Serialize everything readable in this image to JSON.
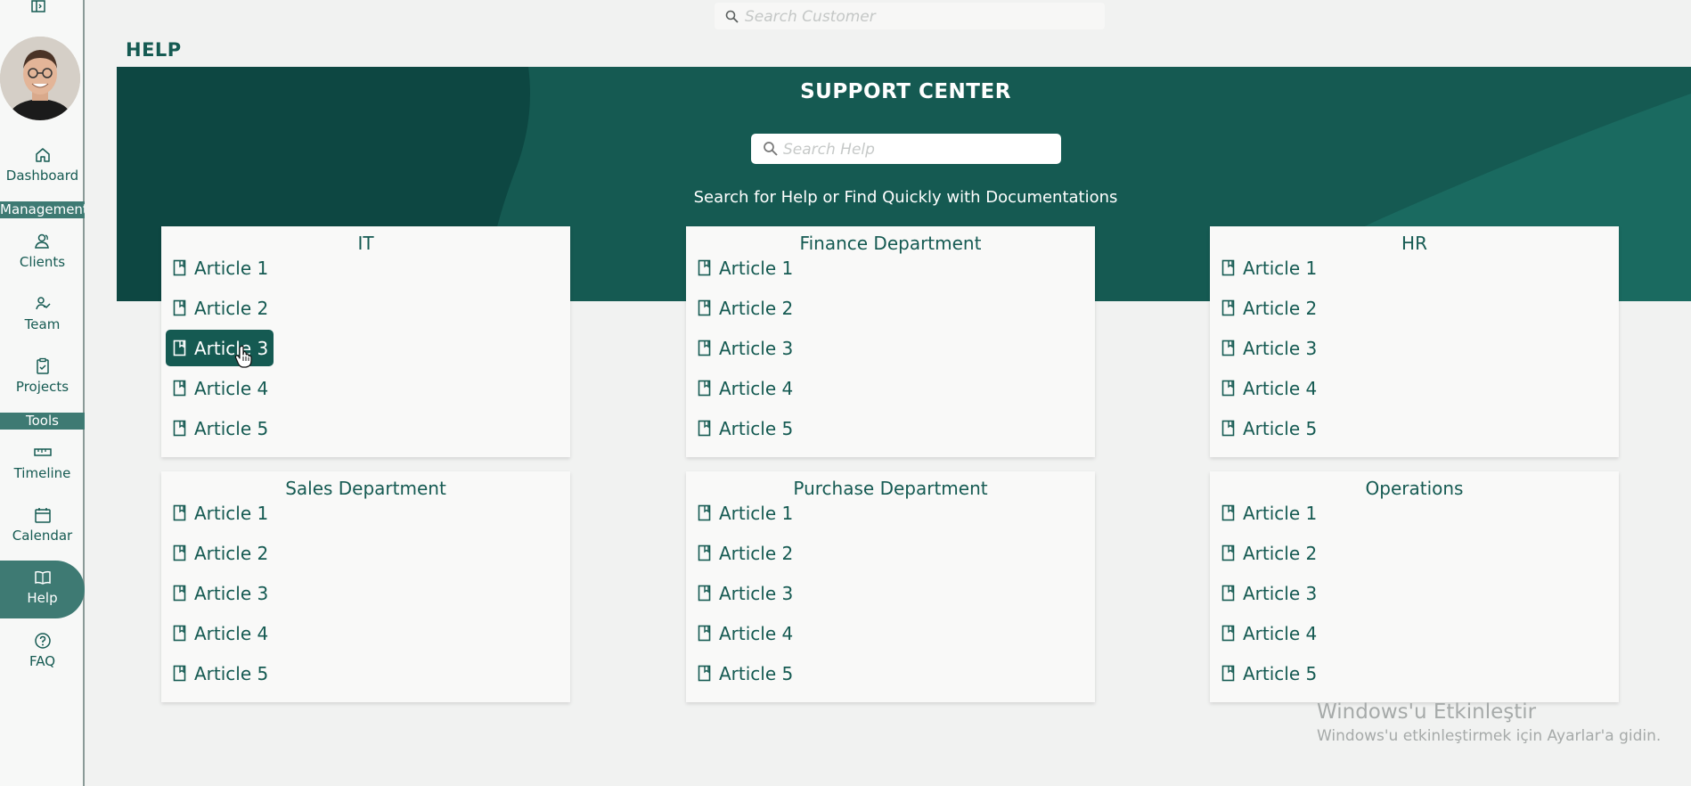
{
  "search": {
    "placeholder": "Search Customer"
  },
  "page": {
    "title": "HELP"
  },
  "sidebar": {
    "items": [
      {
        "label": "Dashboard",
        "icon": "home-icon"
      },
      {
        "label": "Clients",
        "icon": "users-icon"
      },
      {
        "label": "Team",
        "icon": "team-icon"
      },
      {
        "label": "Projects",
        "icon": "clipboard-icon"
      },
      {
        "label": "Timeline",
        "icon": "ruler-icon"
      },
      {
        "label": "Calendar",
        "icon": "calendar-icon"
      },
      {
        "label": "Help",
        "icon": "book-open-icon",
        "active": true
      },
      {
        "label": "FAQ",
        "icon": "question-circle-icon"
      }
    ],
    "sections": [
      "Management",
      "Tools"
    ]
  },
  "hero": {
    "title": "SUPPORT CENTER",
    "search_placeholder": "Search Help",
    "subtitle": "Search for Help or Find Quickly with Documentations"
  },
  "categories": [
    {
      "title": "IT",
      "articles": [
        "Article 1",
        "Article 2",
        "Article 3",
        "Article 4",
        "Article 5"
      ]
    },
    {
      "title": "Finance Department",
      "articles": [
        "Article 1",
        "Article 2",
        "Article 3",
        "Article 4",
        "Article 5"
      ]
    },
    {
      "title": "HR",
      "articles": [
        "Article 1",
        "Article 2",
        "Article 3",
        "Article 4",
        "Article 5"
      ]
    },
    {
      "title": "Sales Department",
      "articles": [
        "Article 1",
        "Article 2",
        "Article 3",
        "Article 4",
        "Article 5"
      ]
    },
    {
      "title": "Purchase Department",
      "articles": [
        "Article 1",
        "Article 2",
        "Article 3",
        "Article 4",
        "Article 5"
      ]
    },
    {
      "title": "Operations",
      "articles": [
        "Article 1",
        "Article 2",
        "Article 3",
        "Article 4",
        "Article 5"
      ]
    }
  ],
  "watermark": {
    "line1": "Windows'u Etkinleştir",
    "line2": "Windows'u etkinleştirmek için Ayarlar'a gidin."
  },
  "colors": {
    "brand": "#155a52",
    "accent": "#3e7a73",
    "background": "#f1f2f1"
  }
}
